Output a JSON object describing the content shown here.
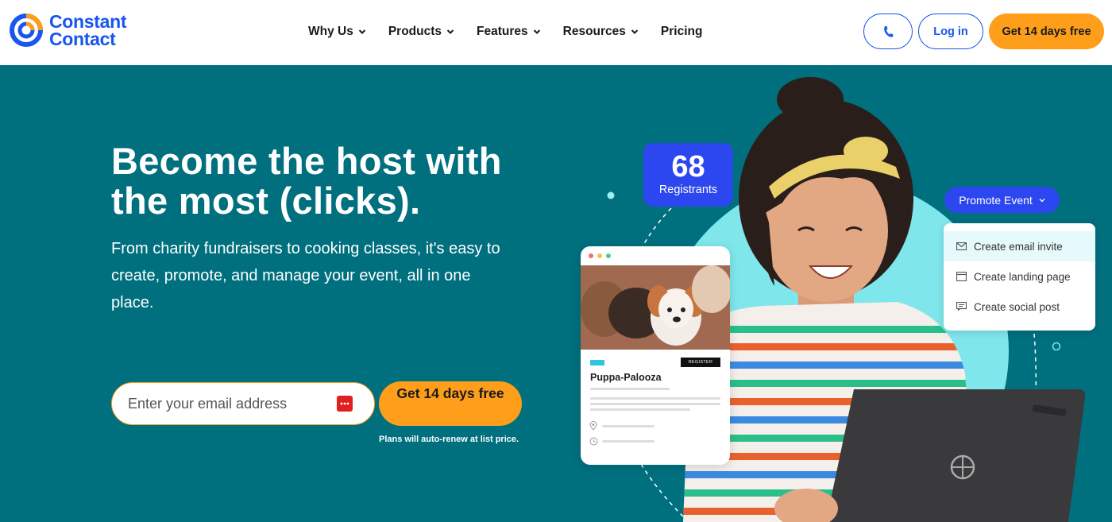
{
  "brand": {
    "name_line1": "Constant",
    "name_line2": "Contact",
    "color": "#1856ED"
  },
  "nav": {
    "menu": [
      {
        "label": "Why Us",
        "has_dropdown": true
      },
      {
        "label": "Products",
        "has_dropdown": true
      },
      {
        "label": "Features",
        "has_dropdown": true
      },
      {
        "label": "Resources",
        "has_dropdown": true
      },
      {
        "label": "Pricing",
        "has_dropdown": false
      }
    ],
    "phone_icon": "phone-icon",
    "login_label": "Log in",
    "trial_label": "Get 14 days free"
  },
  "hero": {
    "title": "Become the host with the most (clicks).",
    "subtitle": "From charity fundraisers to cooking classes, it's easy to create, promote, and manage your event, all in one place.",
    "email_placeholder": "Enter your email address",
    "cta_label": "Get 14 days free",
    "renew_note": "Plans will auto-renew at list price."
  },
  "illustration": {
    "stat_number": "68",
    "stat_label": "Registrants",
    "promote_label": "Promote Event",
    "menu_items": [
      {
        "label": "Create email invite",
        "icon": "mail-icon"
      },
      {
        "label": "Create landing page",
        "icon": "page-icon"
      },
      {
        "label": "Create social post",
        "icon": "post-icon"
      }
    ],
    "event_card": {
      "register_label": "REGISTER",
      "title": "Puppa-Palooza"
    }
  },
  "colors": {
    "hero_bg": "#006F7E",
    "accent_orange": "#FF9E1B",
    "accent_blue": "#2D47F0",
    "circle": "#7FE7EC"
  }
}
